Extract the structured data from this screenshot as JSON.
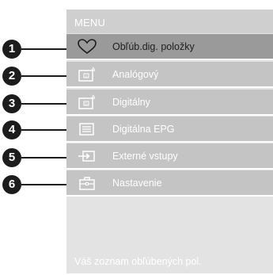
{
  "menu": {
    "header": "MENU",
    "footer": "Váš zoznam obľúbených pol.",
    "items": [
      {
        "number": "1",
        "icon": "heart-icon",
        "label": "Obľúb.dig. položky",
        "selected": true
      },
      {
        "number": "2",
        "icon": "analog-tv-icon",
        "label": "Analógový",
        "selected": false
      },
      {
        "number": "3",
        "icon": "digital-tv-icon",
        "label": "Digitálny",
        "selected": false
      },
      {
        "number": "4",
        "icon": "epg-list-icon",
        "label": "Digitálna EPG",
        "selected": false
      },
      {
        "number": "5",
        "icon": "external-input-icon",
        "label": "Externé vstupy",
        "selected": false
      },
      {
        "number": "6",
        "icon": "settings-toolbox-icon",
        "label": "Nastavenie",
        "selected": false
      }
    ]
  },
  "colors": {
    "panel_bg": "#e3e3e3",
    "item_bg": "#c4c4c4",
    "selected_bg": "#9a9a9a",
    "callout": "#1c1c1c"
  }
}
